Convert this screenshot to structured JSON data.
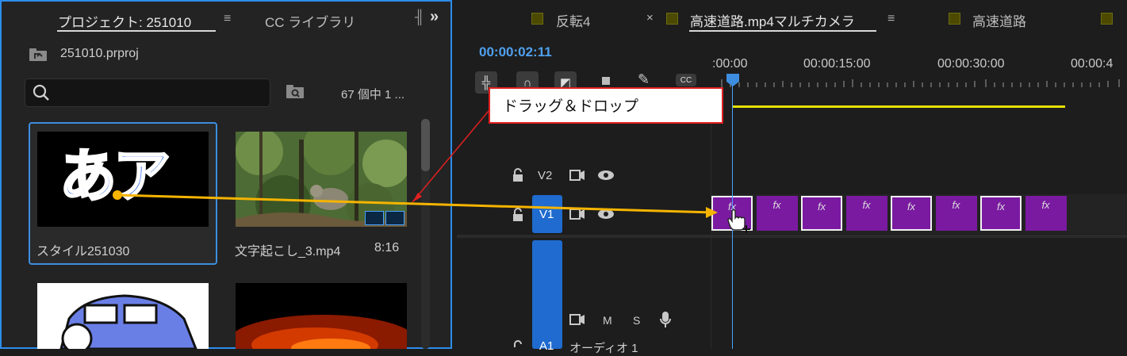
{
  "project": {
    "tab_active": "プロジェクト: 251010",
    "tab_library": "CC ライブラリ",
    "menu_glyph": "≡",
    "expand_glyph": "»",
    "file_name": "251010.prproj",
    "search_placeholder": "",
    "item_count": "67 個中 1 ...",
    "items": [
      {
        "label": "スタイル251030",
        "thumb_text": "あア",
        "duration": ""
      },
      {
        "label": "文字起こし_3.mp4",
        "duration": "8:16"
      }
    ]
  },
  "timeline": {
    "tabs": [
      {
        "label": "反転4"
      },
      {
        "label": "高速道路.mp4マルチカメラ",
        "active": true
      },
      {
        "label": "高速道路"
      }
    ],
    "close_glyph": "×",
    "menu_glyph": "≡",
    "timecode": "00:00:02:11",
    "ruler": [
      ":00:00",
      "00:00:15:00",
      "00:00:30:00",
      "00:00:4"
    ],
    "tracks": {
      "v2": "V2",
      "v1": "V1",
      "a1": "A1",
      "a1_name": "オーディオ 1",
      "mute": "M",
      "solo": "S"
    },
    "clips": [
      {
        "fx": "fx",
        "selected": true
      },
      {
        "fx": "fx",
        "selected": false
      },
      {
        "fx": "fx",
        "selected": true
      },
      {
        "fx": "fx",
        "selected": false
      },
      {
        "fx": "fx",
        "selected": true
      },
      {
        "fx": "fx",
        "selected": false
      },
      {
        "fx": "fx",
        "selected": true
      },
      {
        "fx": "fx",
        "selected": false
      }
    ]
  },
  "annotation": {
    "text": "ドラッグ＆ドロップ",
    "colors": {
      "box_border": "#e02020",
      "arrow": "#f5b400",
      "pointer_line": "#e02020"
    }
  },
  "colors": {
    "accent_blue": "#2d8ceb",
    "clip_purple": "#7a1aa1",
    "work_area_yellow": "#e8e000"
  }
}
